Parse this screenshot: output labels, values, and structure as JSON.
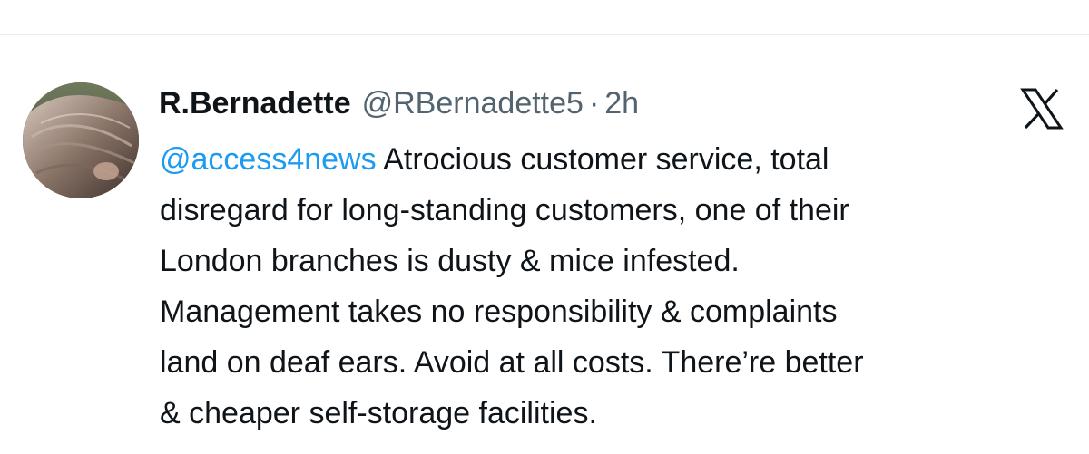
{
  "tweet": {
    "author_name": "R.Bernadette",
    "handle": "@RBernadette5",
    "separator": "·",
    "time": "2h",
    "platform_icon": "x-logo-icon",
    "mention": "@access4news",
    "lines": [
      " Atrocious customer service, total",
      "disregard for long-standing customers, one of their",
      "London branches is dusty & mice infested.",
      "Management takes no responsibility & complaints",
      "land on deaf ears. Avoid at all costs. There’re better",
      "& cheaper self-storage facilities."
    ]
  },
  "colors": {
    "mention": "#1d9bf0",
    "secondary_text": "#536471",
    "primary_text": "#0f1419"
  }
}
